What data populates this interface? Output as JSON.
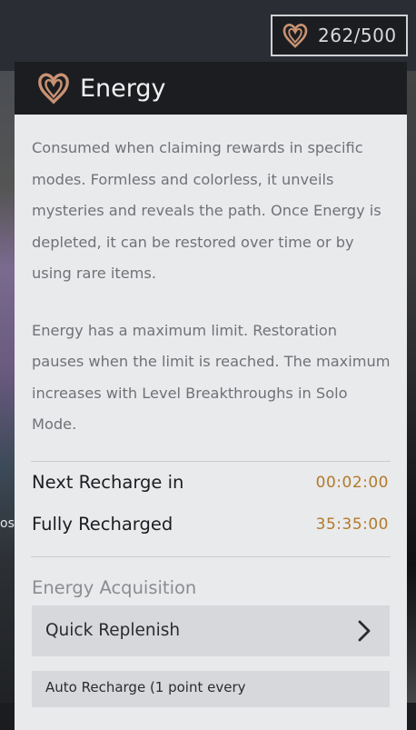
{
  "counter": {
    "icon": "energy-heart-icon",
    "value": "262/500"
  },
  "panel": {
    "icon": "energy-heart-icon",
    "title": "Energy",
    "description": [
      "Consumed when claiming rewards in specific modes. Formless and colorless, it unveils mysteries and reveals the path. Once Energy is depleted, it can be restored over time or by using rare items.",
      "Energy has a maximum limit. Restoration pauses when the limit is reached. The maximum increases with Level Breakthroughs in Solo Mode."
    ],
    "recharge": [
      {
        "label": "Next Recharge in",
        "value": "00:02:00"
      },
      {
        "label": "Fully Recharged",
        "value": "35:35:00"
      }
    ],
    "acquisition_title": "Energy Acquisition",
    "quick_replenish_label": "Quick Replenish",
    "auto_recharge_label": "Auto Recharge (1 point every"
  },
  "background": {
    "left_edge_text": "os"
  },
  "colors": {
    "accent_gold": "#b27a2a",
    "header_dark": "#1b1d20",
    "panel_bg": "#e9eaec",
    "icon_copper": "#c99272"
  }
}
